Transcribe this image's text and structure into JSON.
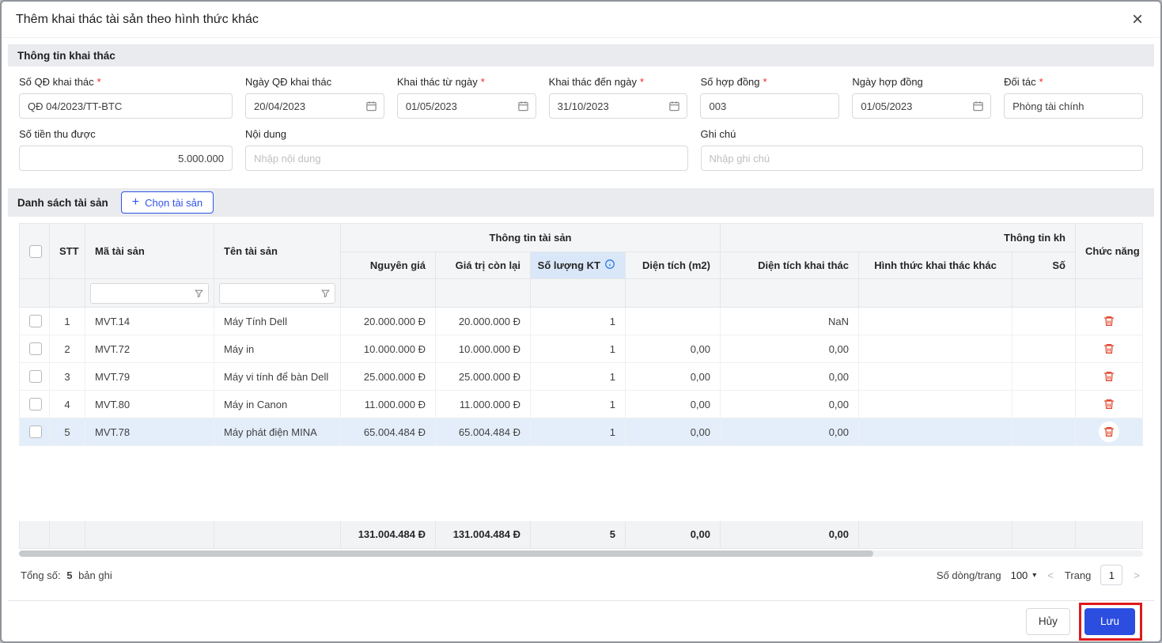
{
  "modal": {
    "title": "Thêm khai thác tài sản theo hình thức khác"
  },
  "icons": {
    "close": "×",
    "add": "+",
    "caret": "▾"
  },
  "sections": {
    "info": "Thông tin khai thác",
    "assets": "Danh sách tài sản"
  },
  "form": {
    "so_qd": {
      "label": "Số QĐ khai thác",
      "value": "QĐ 04/2023/TT-BTC"
    },
    "ngay_qd": {
      "label": "Ngày QĐ khai thác",
      "value": "20/04/2023"
    },
    "tu_ngay": {
      "label": "Khai thác từ ngày",
      "value": "01/05/2023"
    },
    "den_ngay": {
      "label": "Khai thác đến ngày",
      "value": "31/10/2023"
    },
    "so_hop_dong": {
      "label": "Số hợp đồng",
      "value": "003"
    },
    "ngay_hop_dong": {
      "label": "Ngày hợp đồng",
      "value": "01/05/2023"
    },
    "doi_tac": {
      "label": "Đối tác",
      "value": "Phòng tài chính"
    },
    "so_tien": {
      "label": "Số tiền thu được",
      "value": "5.000.000"
    },
    "noi_dung": {
      "label": "Nội dung",
      "placeholder": "Nhập nội dung"
    },
    "ghi_chu": {
      "label": "Ghi chú",
      "placeholder": "Nhập ghi chú"
    }
  },
  "choose_asset_button": "Chọn tài sản",
  "table": {
    "group1": "Thông tin tài sản",
    "group2": "Thông tin kh",
    "headers": {
      "stt": "STT",
      "code": "Mã tài sản",
      "name": "Tên tài sản",
      "cost": "Nguyên giá",
      "remaining": "Giá trị còn lại",
      "qty": "Số lượng KT",
      "area": "Diện tích (m2)",
      "exploit_area": "Diện tích khai thác",
      "other_form": "Hình thức khai thác khác",
      "cut": "Số",
      "actions": "Chức năng"
    },
    "rows": [
      {
        "stt": "1",
        "code": "MVT.14",
        "name": "Máy Tính Dell",
        "cost": "20.000.000 Đ",
        "remaining": "20.000.000 Đ",
        "qty": "1",
        "area": "",
        "exploit_area": "NaN",
        "other_form": ""
      },
      {
        "stt": "2",
        "code": "MVT.72",
        "name": "Máy in",
        "cost": "10.000.000 Đ",
        "remaining": "10.000.000 Đ",
        "qty": "1",
        "area": "0,00",
        "exploit_area": "0,00",
        "other_form": ""
      },
      {
        "stt": "3",
        "code": "MVT.79",
        "name": "Máy vi tính để bàn Dell",
        "cost": "25.000.000 Đ",
        "remaining": "25.000.000 Đ",
        "qty": "1",
        "area": "0,00",
        "exploit_area": "0,00",
        "other_form": ""
      },
      {
        "stt": "4",
        "code": "MVT.80",
        "name": "Máy in Canon",
        "cost": "11.000.000 Đ",
        "remaining": "11.000.000 Đ",
        "qty": "1",
        "area": "0,00",
        "exploit_area": "0,00",
        "other_form": ""
      },
      {
        "stt": "5",
        "code": "MVT.78",
        "name": "Máy phát điện MINA",
        "cost": "65.004.484 Đ",
        "remaining": "65.004.484 Đ",
        "qty": "1",
        "area": "0,00",
        "exploit_area": "0,00",
        "other_form": ""
      }
    ],
    "summary": {
      "cost": "131.004.484 Đ",
      "remaining": "131.004.484 Đ",
      "qty": "5",
      "area": "0,00",
      "exploit_area": "0,00"
    }
  },
  "pagination": {
    "total_prefix": "Tổng số:",
    "total_count": "5",
    "total_suffix": "bản ghi",
    "rows_per_page_label": "Số dòng/trang",
    "rows_per_page": "100",
    "prev": "<",
    "page_label": "Trang",
    "page": "1",
    "next": ">"
  },
  "footer": {
    "cancel": "Hủy",
    "save": "Lưu"
  },
  "colors": {
    "primary": "#2b4ee0",
    "danger": "#e2492f",
    "highlight_row": "#e4eefa",
    "annotation": "#e01a1a"
  }
}
